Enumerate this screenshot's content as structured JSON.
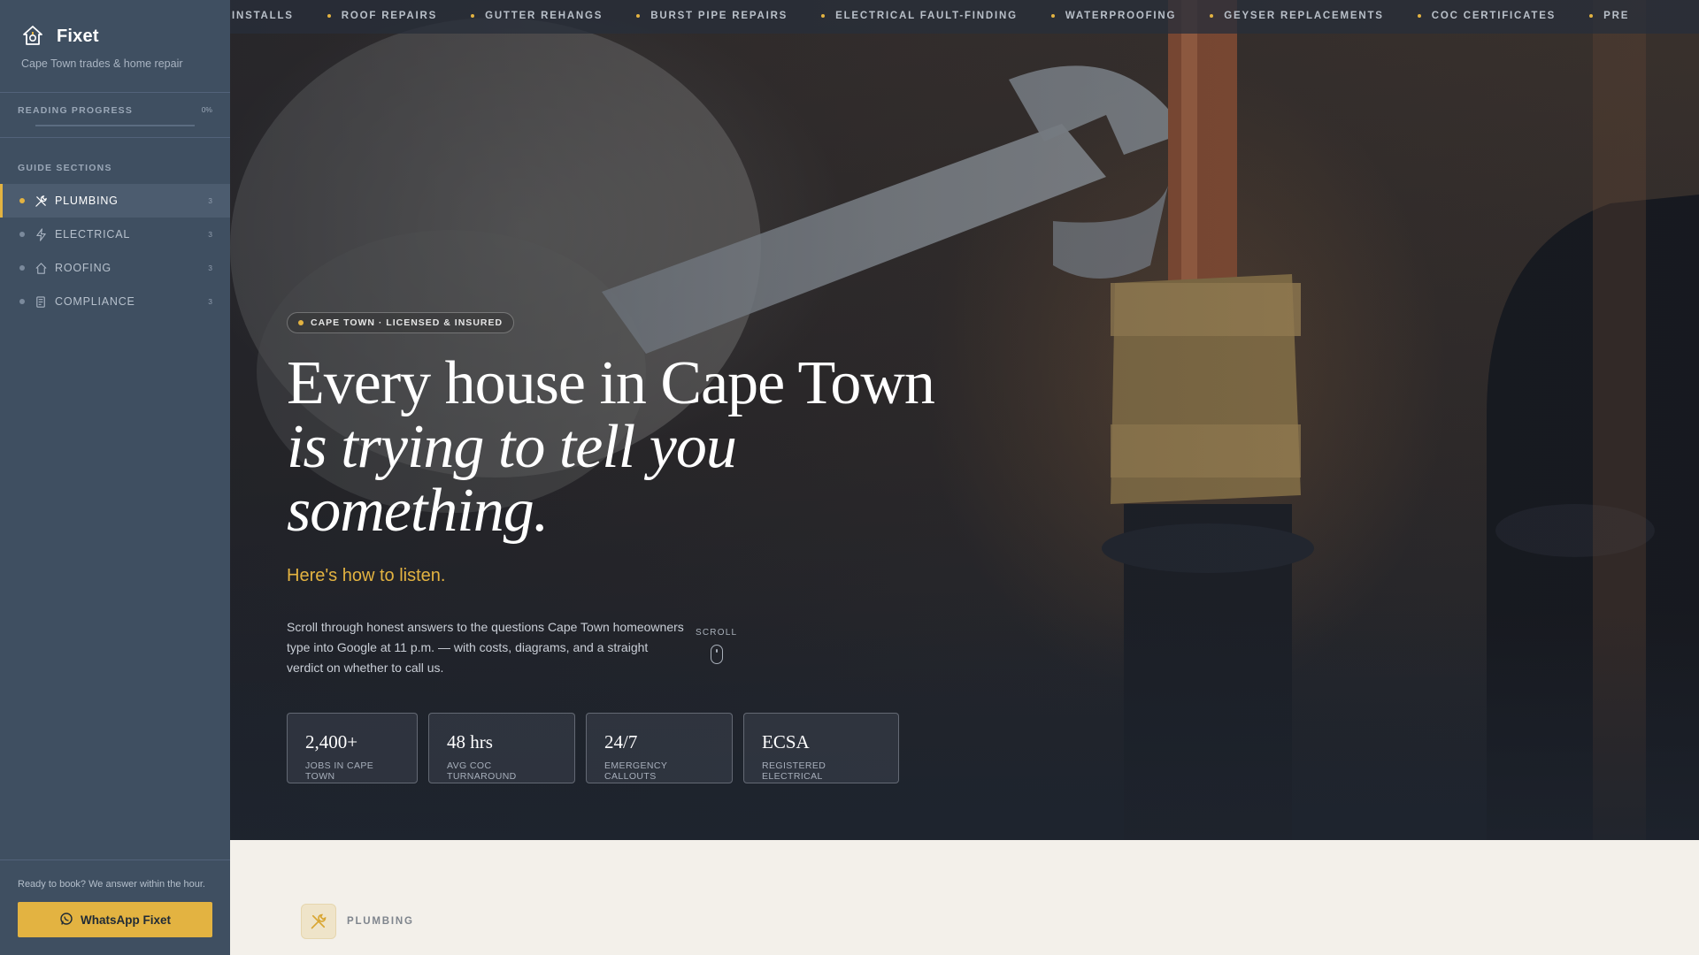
{
  "brand": {
    "name": "Fixet",
    "tagline": "Cape Town trades & home repair",
    "logo_icon": "wrench-house-logo-icon"
  },
  "progress": {
    "label": "READING PROGRESS",
    "value_text": "0%",
    "fraction": 0
  },
  "sections": {
    "label": "GUIDE SECTIONS",
    "items": [
      {
        "label": "PLUMBING",
        "count": "3",
        "icon": "tools-icon",
        "active": true
      },
      {
        "label": "ELECTRICAL",
        "count": "3",
        "icon": "lightning-icon",
        "active": false
      },
      {
        "label": "ROOFING",
        "count": "3",
        "icon": "house-icon",
        "active": false
      },
      {
        "label": "COMPLIANCE",
        "count": "3",
        "icon": "document-icon",
        "active": false
      }
    ]
  },
  "cta": {
    "text": "Ready to book? We answer within the hour.",
    "button_label": "WhatsApp Fixet",
    "button_icon": "whatsapp-icon"
  },
  "ticker": {
    "items": [
      "INSTALLS",
      "ROOF REPAIRS",
      "GUTTER REHANGS",
      "BURST PIPE REPAIRS",
      "ELECTRICAL FAULT-FINDING",
      "WATERPROOFING",
      "GEYSER REPLACEMENTS",
      "COC CERTIFICATES",
      "PRE"
    ]
  },
  "hero": {
    "badge": "CAPE TOWN · LICENSED & INSURED",
    "headline_line1": "Every house in Cape Town",
    "headline_line2": "is trying to tell you",
    "headline_line3": "something.",
    "subhead": "Here's how to listen.",
    "body": "Scroll through honest answers to the questions Cape Town homeowners type into Google at 11 p.m. — with costs, diagrams, and a straight verdict on whether to call us.",
    "scroll_label": "SCROLL"
  },
  "stats": [
    {
      "value": "2,400+",
      "label": "JOBS IN CAPE TOWN"
    },
    {
      "value": "48 hrs",
      "label": "AVG COC TURNAROUND"
    },
    {
      "value": "24/7",
      "label": "EMERGENCY CALLOUTS"
    },
    {
      "value": "ECSA",
      "label": "REGISTERED ELECTRICAL"
    }
  ],
  "section_heading": {
    "label": "PLUMBING",
    "icon": "tools-icon"
  },
  "colors": {
    "accent": "#e3b341",
    "sidebar": "#3f4f61",
    "page": "#f3f0ea"
  }
}
